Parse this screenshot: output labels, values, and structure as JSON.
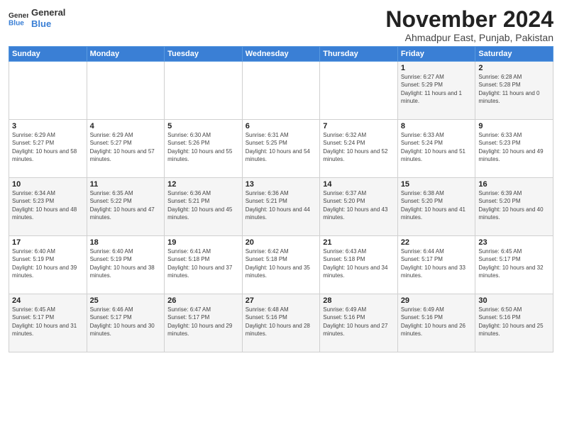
{
  "logo": {
    "line1": "General",
    "line2": "Blue"
  },
  "title": "November 2024",
  "location": "Ahmadpur East, Punjab, Pakistan",
  "weekdays": [
    "Sunday",
    "Monday",
    "Tuesday",
    "Wednesday",
    "Thursday",
    "Friday",
    "Saturday"
  ],
  "weeks": [
    [
      {
        "day": "",
        "info": ""
      },
      {
        "day": "",
        "info": ""
      },
      {
        "day": "",
        "info": ""
      },
      {
        "day": "",
        "info": ""
      },
      {
        "day": "",
        "info": ""
      },
      {
        "day": "1",
        "info": "Sunrise: 6:27 AM\nSunset: 5:29 PM\nDaylight: 11 hours and 1 minute."
      },
      {
        "day": "2",
        "info": "Sunrise: 6:28 AM\nSunset: 5:28 PM\nDaylight: 11 hours and 0 minutes."
      }
    ],
    [
      {
        "day": "3",
        "info": "Sunrise: 6:29 AM\nSunset: 5:27 PM\nDaylight: 10 hours and 58 minutes."
      },
      {
        "day": "4",
        "info": "Sunrise: 6:29 AM\nSunset: 5:27 PM\nDaylight: 10 hours and 57 minutes."
      },
      {
        "day": "5",
        "info": "Sunrise: 6:30 AM\nSunset: 5:26 PM\nDaylight: 10 hours and 55 minutes."
      },
      {
        "day": "6",
        "info": "Sunrise: 6:31 AM\nSunset: 5:25 PM\nDaylight: 10 hours and 54 minutes."
      },
      {
        "day": "7",
        "info": "Sunrise: 6:32 AM\nSunset: 5:24 PM\nDaylight: 10 hours and 52 minutes."
      },
      {
        "day": "8",
        "info": "Sunrise: 6:33 AM\nSunset: 5:24 PM\nDaylight: 10 hours and 51 minutes."
      },
      {
        "day": "9",
        "info": "Sunrise: 6:33 AM\nSunset: 5:23 PM\nDaylight: 10 hours and 49 minutes."
      }
    ],
    [
      {
        "day": "10",
        "info": "Sunrise: 6:34 AM\nSunset: 5:23 PM\nDaylight: 10 hours and 48 minutes."
      },
      {
        "day": "11",
        "info": "Sunrise: 6:35 AM\nSunset: 5:22 PM\nDaylight: 10 hours and 47 minutes."
      },
      {
        "day": "12",
        "info": "Sunrise: 6:36 AM\nSunset: 5:21 PM\nDaylight: 10 hours and 45 minutes."
      },
      {
        "day": "13",
        "info": "Sunrise: 6:36 AM\nSunset: 5:21 PM\nDaylight: 10 hours and 44 minutes."
      },
      {
        "day": "14",
        "info": "Sunrise: 6:37 AM\nSunset: 5:20 PM\nDaylight: 10 hours and 43 minutes."
      },
      {
        "day": "15",
        "info": "Sunrise: 6:38 AM\nSunset: 5:20 PM\nDaylight: 10 hours and 41 minutes."
      },
      {
        "day": "16",
        "info": "Sunrise: 6:39 AM\nSunset: 5:20 PM\nDaylight: 10 hours and 40 minutes."
      }
    ],
    [
      {
        "day": "17",
        "info": "Sunrise: 6:40 AM\nSunset: 5:19 PM\nDaylight: 10 hours and 39 minutes."
      },
      {
        "day": "18",
        "info": "Sunrise: 6:40 AM\nSunset: 5:19 PM\nDaylight: 10 hours and 38 minutes."
      },
      {
        "day": "19",
        "info": "Sunrise: 6:41 AM\nSunset: 5:18 PM\nDaylight: 10 hours and 37 minutes."
      },
      {
        "day": "20",
        "info": "Sunrise: 6:42 AM\nSunset: 5:18 PM\nDaylight: 10 hours and 35 minutes."
      },
      {
        "day": "21",
        "info": "Sunrise: 6:43 AM\nSunset: 5:18 PM\nDaylight: 10 hours and 34 minutes."
      },
      {
        "day": "22",
        "info": "Sunrise: 6:44 AM\nSunset: 5:17 PM\nDaylight: 10 hours and 33 minutes."
      },
      {
        "day": "23",
        "info": "Sunrise: 6:45 AM\nSunset: 5:17 PM\nDaylight: 10 hours and 32 minutes."
      }
    ],
    [
      {
        "day": "24",
        "info": "Sunrise: 6:45 AM\nSunset: 5:17 PM\nDaylight: 10 hours and 31 minutes."
      },
      {
        "day": "25",
        "info": "Sunrise: 6:46 AM\nSunset: 5:17 PM\nDaylight: 10 hours and 30 minutes."
      },
      {
        "day": "26",
        "info": "Sunrise: 6:47 AM\nSunset: 5:17 PM\nDaylight: 10 hours and 29 minutes."
      },
      {
        "day": "27",
        "info": "Sunrise: 6:48 AM\nSunset: 5:16 PM\nDaylight: 10 hours and 28 minutes."
      },
      {
        "day": "28",
        "info": "Sunrise: 6:49 AM\nSunset: 5:16 PM\nDaylight: 10 hours and 27 minutes."
      },
      {
        "day": "29",
        "info": "Sunrise: 6:49 AM\nSunset: 5:16 PM\nDaylight: 10 hours and 26 minutes."
      },
      {
        "day": "30",
        "info": "Sunrise: 6:50 AM\nSunset: 5:16 PM\nDaylight: 10 hours and 25 minutes."
      }
    ]
  ]
}
